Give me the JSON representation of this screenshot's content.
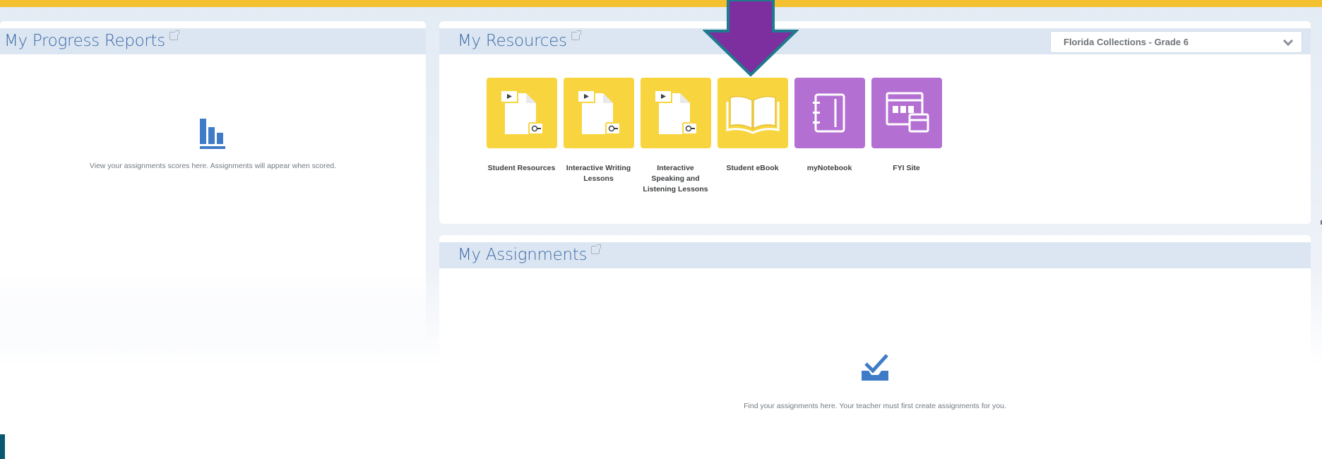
{
  "colors": {
    "accent_bar": "#f3c12f",
    "title_text": "#3c6aa6",
    "header_band": "#dce6f2",
    "tile_yellow": "#f8d53f",
    "tile_purple": "#b46fd3",
    "icon_blue": "#3f7cc7",
    "arrow_fill": "#7d2fa0",
    "arrow_outline": "#1e7a8c"
  },
  "progress_reports": {
    "title": "My Progress Reports",
    "icon": "bar-chart-icon",
    "empty_message": "View your assignments scores here. Assignments will appear when scored."
  },
  "resources": {
    "title": "My Resources",
    "collection_select": {
      "selected": "Florida Collections - Grade 6"
    },
    "tiles": [
      {
        "label": "Student Resources",
        "icon": "document-video-icon",
        "color": "yellow"
      },
      {
        "label": "Interactive Writing Lessons",
        "icon": "document-video-icon",
        "color": "yellow"
      },
      {
        "label": "Interactive Speaking and Listening Lessons",
        "icon": "document-video-icon",
        "color": "yellow"
      },
      {
        "label": "Student eBook",
        "icon": "open-book-icon",
        "color": "yellow"
      },
      {
        "label": "myNotebook",
        "icon": "notebook-icon",
        "color": "purple"
      },
      {
        "label": "FYI Site",
        "icon": "website-icon",
        "color": "purple"
      }
    ]
  },
  "assignments": {
    "title": "My Assignments",
    "icon": "inbox-check-icon",
    "empty_message": "Find your assignments here. Your teacher must first create assignments for you."
  },
  "overlay": {
    "arrow_icon": "down-arrow-icon"
  }
}
